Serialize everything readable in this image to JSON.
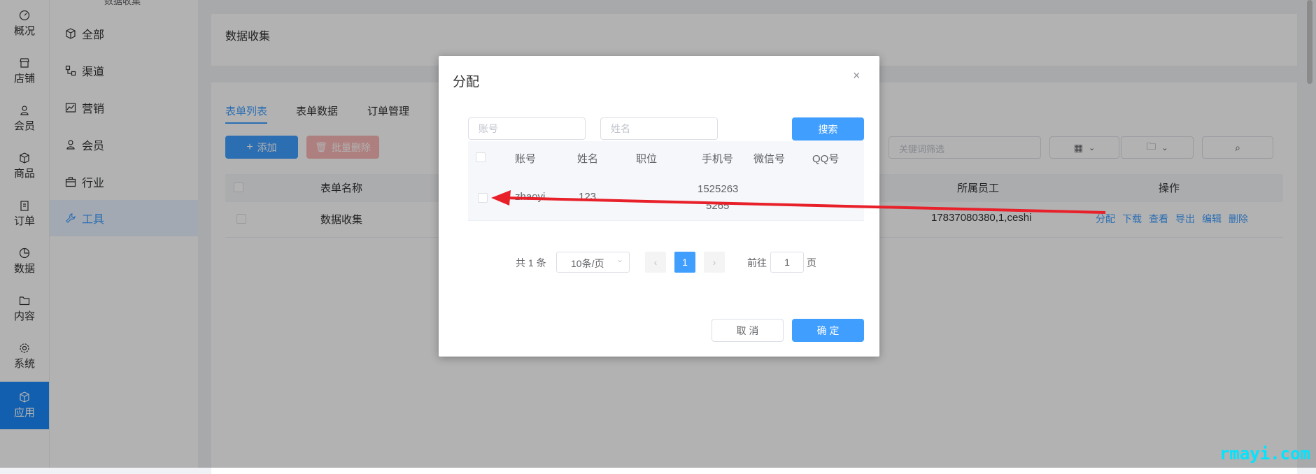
{
  "rail": {
    "top_label": "数据收集",
    "items": [
      {
        "label": "概况",
        "icon": "dashboard-icon"
      },
      {
        "label": "店铺",
        "icon": "store-icon"
      },
      {
        "label": "会员",
        "icon": "user-icon"
      },
      {
        "label": "商品",
        "icon": "box-icon"
      },
      {
        "label": "订单",
        "icon": "clipboard-icon"
      },
      {
        "label": "数据",
        "icon": "pie-chart-icon"
      },
      {
        "label": "内容",
        "icon": "folder-icon"
      },
      {
        "label": "系统",
        "icon": "gear-icon"
      },
      {
        "label": "应用",
        "icon": "cube-icon"
      }
    ]
  },
  "submenu": {
    "items": [
      {
        "label": "全部",
        "icon": "cube-icon"
      },
      {
        "label": "渠道",
        "icon": "channel-icon"
      },
      {
        "label": "营销",
        "icon": "chart-icon"
      },
      {
        "label": "会员",
        "icon": "user-icon"
      },
      {
        "label": "行业",
        "icon": "briefcase-icon"
      },
      {
        "label": "工具",
        "icon": "wrench-icon"
      }
    ]
  },
  "page": {
    "title": "数据收集"
  },
  "tabs": [
    "表单列表",
    "表单数据",
    "订单管理"
  ],
  "toolbar": {
    "add_label": "添加",
    "batch_delete_label": "批量删除",
    "keyword_placeholder": "关键词筛选"
  },
  "table": {
    "headers": [
      "表单名称",
      "所属员工",
      "操作"
    ],
    "rows": [
      {
        "name": "数据收集",
        "staff": "17837080380,1,ceshi"
      }
    ],
    "actions": [
      "分配",
      "下载",
      "查看",
      "导出",
      "编辑",
      "删除"
    ]
  },
  "dialog": {
    "title": "分配",
    "account_placeholder": "账号",
    "name_placeholder": "姓名",
    "search_label": "搜索",
    "headers": [
      "账号",
      "姓名",
      "职位",
      "手机号",
      "微信号",
      "QQ号"
    ],
    "rows": [
      {
        "account": "zhaoyi",
        "name": "123",
        "position": "",
        "phone_line1": "1525263",
        "phone_line2": "5265",
        "wechat": "",
        "qq": ""
      }
    ],
    "pagination": {
      "total": "共 1 条",
      "page_size": "10条/页",
      "current": "1",
      "goto_prefix": "前往",
      "goto_value": "1",
      "goto_suffix": "页"
    },
    "cancel_label": "取 消",
    "confirm_label": "确 定"
  },
  "watermark": "rmayi.com",
  "colors": {
    "primary": "#409eff",
    "danger": "#f56c6c",
    "arrow": "#e8202a",
    "active_rail": "#1989fa"
  }
}
